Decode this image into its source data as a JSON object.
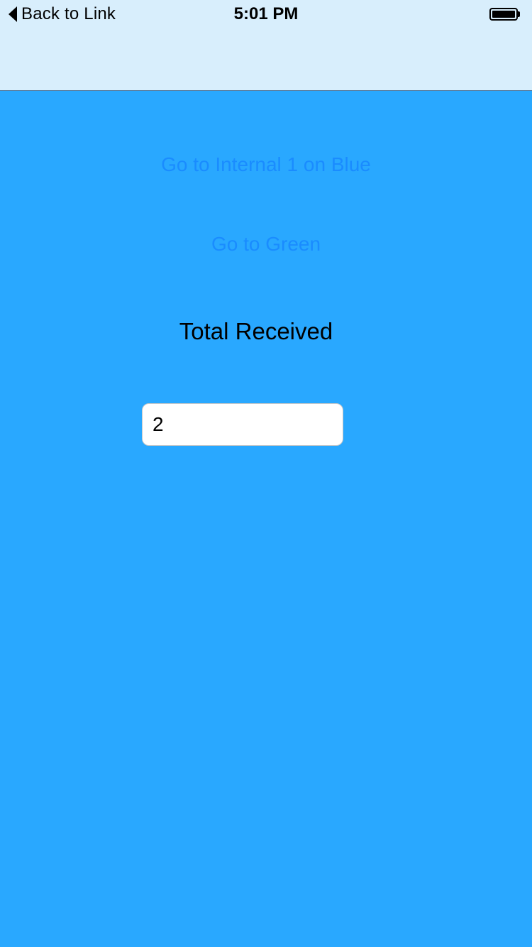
{
  "status_bar": {
    "back_label": "Back to Link",
    "time": "5:01 PM",
    "battery_icon": "battery-full-icon"
  },
  "main": {
    "link_internal_label": "Go to Internal 1 on Blue",
    "link_green_label": "Go to Green",
    "total_label": "Total Received",
    "total_value": "2"
  },
  "colors": {
    "background": "#29a8ff",
    "nav_bar": "#d8eefc",
    "link": "#1a8cff"
  }
}
